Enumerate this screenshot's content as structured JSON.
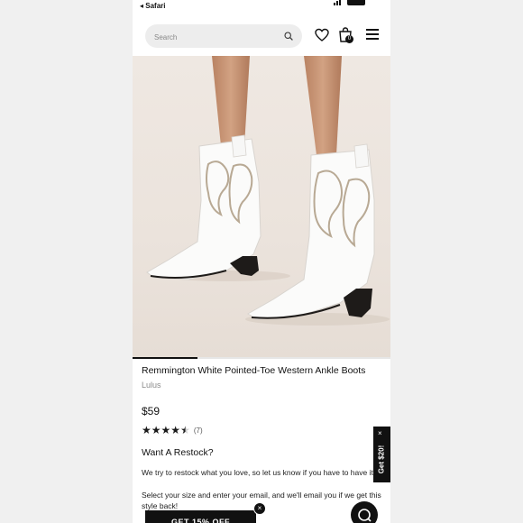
{
  "status_bar": {
    "back_app": "◂ Safari"
  },
  "header": {
    "search_placeholder": "Search",
    "cart_count": "0"
  },
  "product": {
    "title": "Remmington White Pointed-Toe Western Ankle Boots",
    "brand": "Lulus",
    "price": "$59",
    "rating_value": 4.5,
    "rating_count": "(7)",
    "image_progress": 0.25
  },
  "restock": {
    "title": "Want A Restock?",
    "text1": "We try to restock what you love, so let us know if you have to have it!",
    "text2": "Select your size and enter your email, and we'll email you if we get this style back!"
  },
  "promos": {
    "side_tab": "Get $20!",
    "side_close": "×",
    "banner": "GET 15% OFF",
    "banner_close": "×"
  },
  "colors": {
    "accent": "#111111",
    "image_bg": "#ece4dd"
  }
}
